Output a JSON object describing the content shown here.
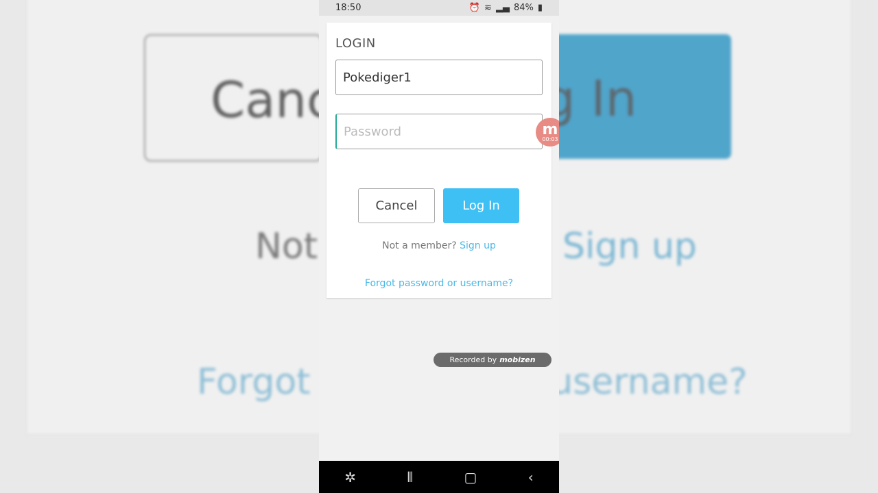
{
  "status": {
    "time": "18:50",
    "battery": "84%"
  },
  "login": {
    "title": "LOGIN",
    "username_value": "Pokediger1",
    "password_placeholder": "Password",
    "cancel": "Cancel",
    "login": "Log In",
    "not_member": "Not a member?",
    "sign_up": "Sign up",
    "forgot": "Forgot password or username?"
  },
  "overlay": {
    "recorded_by": "Recorded by",
    "brand": "mobizen",
    "timer": "00:03",
    "bubble_letter": "m"
  },
  "background": {
    "cancel": "Cancel",
    "login": "Log In",
    "not": "Not a member?",
    "sign_up": "Sign up",
    "forgot": "Forgot password or username?"
  }
}
